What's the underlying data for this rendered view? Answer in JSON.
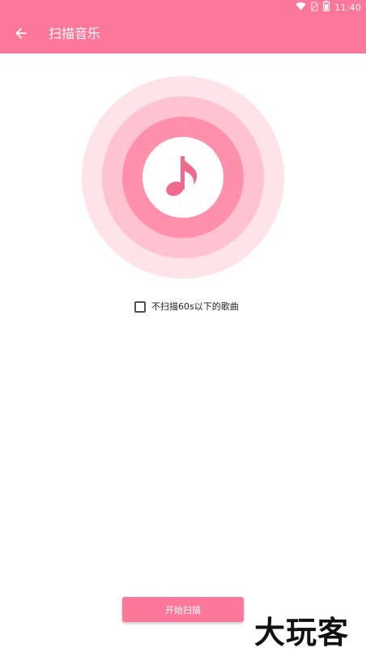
{
  "status_bar": {
    "time": "11:40",
    "icons": [
      "wifi-icon",
      "no-sim-icon",
      "battery-icon"
    ]
  },
  "app_bar": {
    "back_icon": "arrow-left-icon",
    "title": "扫描音乐"
  },
  "scan_graphic": {
    "icon": "music-note-icon",
    "colors": {
      "outer": "#ffe3ea",
      "middle": "#ffc2d1",
      "inner": "#ff8fab",
      "core": "#ffffff",
      "note": "#f06a8e"
    }
  },
  "options": {
    "skip_short": {
      "label": "不扫描60s以下的歌曲",
      "checked": false
    }
  },
  "actions": {
    "start_scan_label": "开始扫描"
  },
  "watermark": {
    "text": "大玩客"
  },
  "theme": {
    "primary": "#fd779a",
    "on_primary": "#ffffff"
  }
}
